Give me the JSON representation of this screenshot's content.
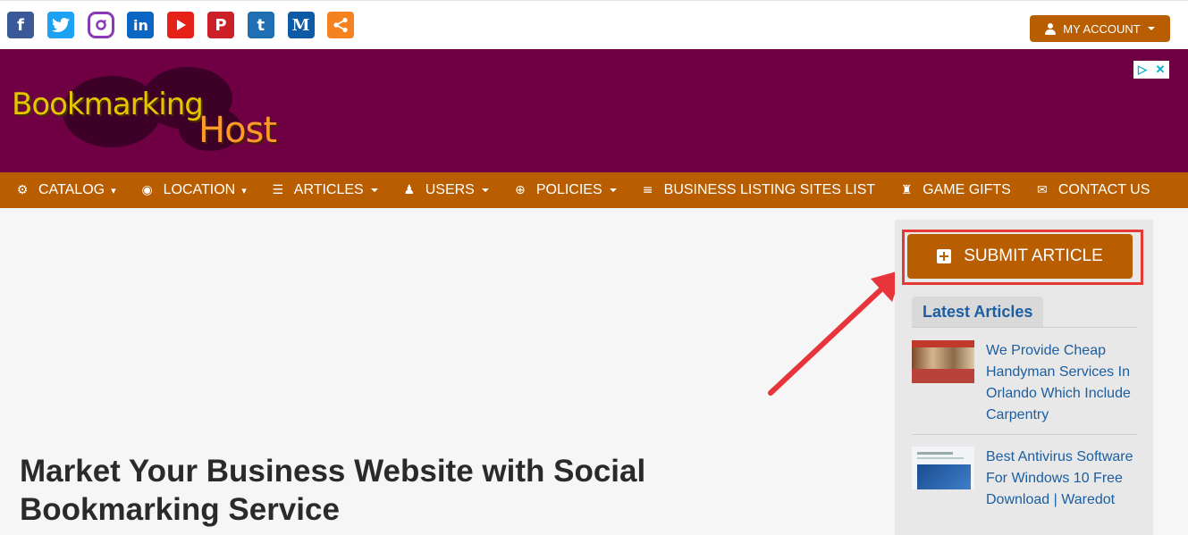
{
  "header": {
    "social_icons": [
      "facebook-icon",
      "twitter-icon",
      "instagram-icon",
      "linkedin-icon",
      "youtube-icon",
      "pinterest-icon",
      "tumblr-icon",
      "medium-icon",
      "share-icon"
    ],
    "account_label": "MY ACCOUNT"
  },
  "banner": {
    "logo_line1": "Bookmarking",
    "logo_line2": "Host",
    "background_color": "#6f0044"
  },
  "nav": {
    "items": [
      {
        "label": "CATALOG",
        "icon": "cogs-icon"
      },
      {
        "label": "LOCATION",
        "icon": "life-ring-icon"
      },
      {
        "label": "ARTICLES",
        "icon": "list-icon"
      },
      {
        "label": "USERS",
        "icon": "user-tie-icon"
      },
      {
        "label": "POLICIES",
        "icon": "crosshair-icon"
      },
      {
        "label": "BUSINESS LISTING SITES LIST",
        "icon": "align-left-icon"
      },
      {
        "label": "GAME GIFTS",
        "icon": "chess-rook-icon"
      },
      {
        "label": "CONTACT US",
        "icon": "envelope-icon"
      }
    ],
    "background_color": "#b85e00"
  },
  "main": {
    "page_title": "Market Your Business Website with Social Bookmarking Service"
  },
  "sidebar": {
    "submit_label": "SUBMIT ARTICLE",
    "latest_title": "Latest Articles",
    "articles": [
      {
        "title": "We Provide Cheap Handyman Services In Orlando Which Include Carpentry"
      },
      {
        "title": "Best Antivirus Software For Windows 10 Free Download | Waredot"
      }
    ]
  },
  "colors": {
    "accent": "#b85e00",
    "link": "#1c5ea0",
    "highlight": "#e53935"
  }
}
